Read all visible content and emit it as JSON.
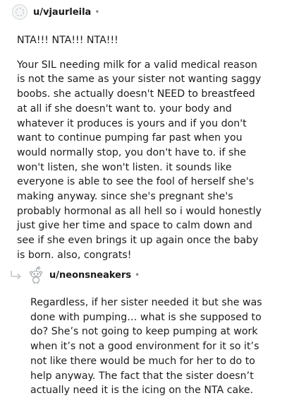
{
  "comments": [
    {
      "username": "u/vjaurleila",
      "separator": "•",
      "paragraphs": [
        "NTA!!! NTA!!! NTA!!!",
        "Your SIL needing milk for a valid medical reason is not the same as your sister not wanting saggy boobs. she actually doesn't NEED to breastfeed at all if she doesn't want to. your body and whatever it produces is yours and if you don't want to continue pumping far past when you would normally stop, you don't have to. if she won't listen, she won't listen. it sounds like everyone is able to see the fool of herself she's making anyway. since she's pregnant she's probably hormonal as all hell so i would honestly just give her time and space to calm down and see if she even brings it up again once the baby is born. also, congrats!"
      ]
    },
    {
      "username": "u/neonsneakers",
      "separator": "•",
      "paragraphs": [
        "Regardless, if her sister needed it but she was done with pumping… what is she supposed to do? She’s not going to keep pumping at work when it’s not a good environment for it so it’s not like there would be much for her to do to help anyway. The fact that the sister doesn’t actually need it is the icing on the NTA cake."
      ]
    }
  ],
  "icons": {
    "avatar_1": "default-avatar-icon",
    "avatar_2": "snoo-avatar-icon",
    "reply": "reply-arrow-icon"
  }
}
